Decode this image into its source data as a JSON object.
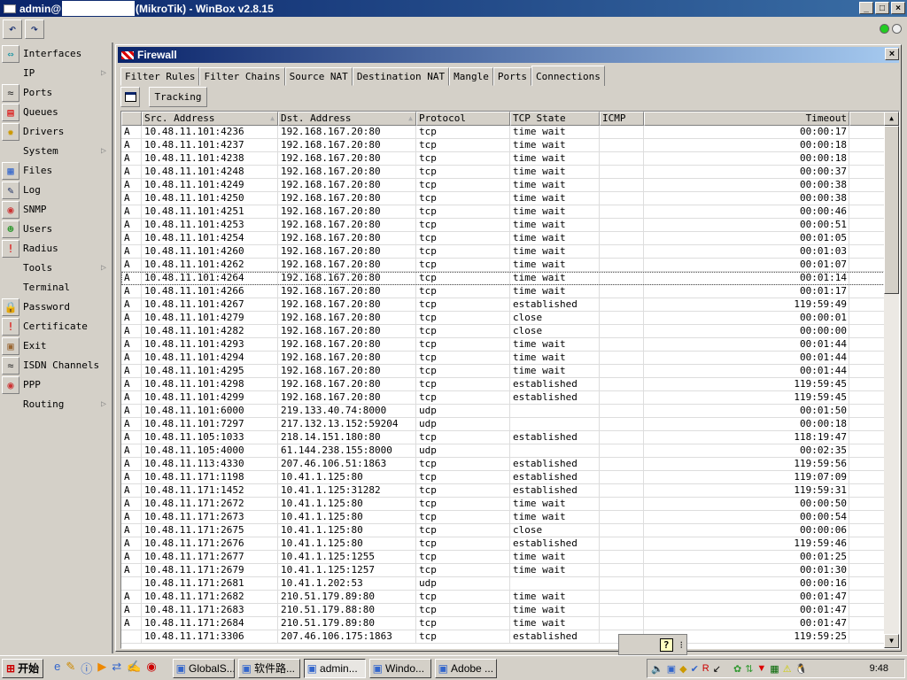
{
  "window": {
    "title_prefix": "admin@",
    "title_suffix": "(MikroTik) - WinBox v2.8.15",
    "minimize": "_",
    "maximize": "□",
    "close": "×"
  },
  "toolbar": {
    "undo": "↶",
    "redo": "↷"
  },
  "sidebar": {
    "items": [
      {
        "label": "Interfaces",
        "icon": "interfaces-icon",
        "glyph": "⇔",
        "color": "#0a8fa0",
        "arrow": false
      },
      {
        "label": "IP",
        "icon": "",
        "glyph": "",
        "color": "",
        "arrow": true
      },
      {
        "label": "Ports",
        "icon": "ports-icon",
        "glyph": "≈",
        "color": "#333",
        "arrow": false
      },
      {
        "label": "Queues",
        "icon": "queues-icon",
        "glyph": "▤",
        "color": "#d00",
        "arrow": false
      },
      {
        "label": "Drivers",
        "icon": "drivers-icon",
        "glyph": "✹",
        "color": "#c90",
        "arrow": false
      },
      {
        "label": "System",
        "icon": "",
        "glyph": "",
        "color": "",
        "arrow": true
      },
      {
        "label": "Files",
        "icon": "files-icon",
        "glyph": "▦",
        "color": "#36c",
        "arrow": false
      },
      {
        "label": "Log",
        "icon": "log-icon",
        "glyph": "✎",
        "color": "#236",
        "arrow": false
      },
      {
        "label": "SNMP",
        "icon": "snmp-icon",
        "glyph": "◉",
        "color": "#c33",
        "arrow": false
      },
      {
        "label": "Users",
        "icon": "users-icon",
        "glyph": "☻",
        "color": "#393",
        "arrow": false
      },
      {
        "label": "Radius",
        "icon": "radius-icon",
        "glyph": "!",
        "color": "#d00",
        "arrow": false
      },
      {
        "label": "Tools",
        "icon": "",
        "glyph": "",
        "color": "",
        "arrow": true
      },
      {
        "label": "Terminal",
        "icon": "",
        "glyph": "",
        "color": "",
        "arrow": false
      },
      {
        "label": "Password",
        "icon": "password-icon",
        "glyph": "🔒",
        "color": "#363",
        "arrow": false
      },
      {
        "label": "Certificate",
        "icon": "certificate-icon",
        "glyph": "!",
        "color": "#d00",
        "arrow": false
      },
      {
        "label": "Exit",
        "icon": "exit-icon",
        "glyph": "▣",
        "color": "#963",
        "arrow": false
      },
      {
        "label": "ISDN Channels",
        "icon": "isdn-icon",
        "glyph": "≈",
        "color": "#333",
        "arrow": false
      },
      {
        "label": "PPP",
        "icon": "ppp-icon",
        "glyph": "◉",
        "color": "#c33",
        "arrow": false
      },
      {
        "label": "Routing",
        "icon": "",
        "glyph": "",
        "color": "",
        "arrow": true
      }
    ]
  },
  "firewall": {
    "title": "Firewall",
    "close": "×",
    "tabs": [
      "Filter Rules",
      "Filter Chains",
      "Source NAT",
      "Destination NAT",
      "Mangle",
      "Ports",
      "Connections"
    ],
    "active_tab": "Connections",
    "tracking_button": "Tracking",
    "columns": [
      "",
      "Src. Address",
      "Dst. Address",
      "Protocol",
      "TCP State",
      "ICMP",
      "Timeout"
    ],
    "rows": [
      [
        "A",
        "10.48.11.101:4236",
        "192.168.167.20:80",
        "tcp",
        "time wait",
        "",
        "00:00:17"
      ],
      [
        "A",
        "10.48.11.101:4237",
        "192.168.167.20:80",
        "tcp",
        "time wait",
        "",
        "00:00:18"
      ],
      [
        "A",
        "10.48.11.101:4238",
        "192.168.167.20:80",
        "tcp",
        "time wait",
        "",
        "00:00:18"
      ],
      [
        "A",
        "10.48.11.101:4248",
        "192.168.167.20:80",
        "tcp",
        "time wait",
        "",
        "00:00:37"
      ],
      [
        "A",
        "10.48.11.101:4249",
        "192.168.167.20:80",
        "tcp",
        "time wait",
        "",
        "00:00:38"
      ],
      [
        "A",
        "10.48.11.101:4250",
        "192.168.167.20:80",
        "tcp",
        "time wait",
        "",
        "00:00:38"
      ],
      [
        "A",
        "10.48.11.101:4251",
        "192.168.167.20:80",
        "tcp",
        "time wait",
        "",
        "00:00:46"
      ],
      [
        "A",
        "10.48.11.101:4253",
        "192.168.167.20:80",
        "tcp",
        "time wait",
        "",
        "00:00:51"
      ],
      [
        "A",
        "10.48.11.101:4254",
        "192.168.167.20:80",
        "tcp",
        "time wait",
        "",
        "00:01:05"
      ],
      [
        "A",
        "10.48.11.101:4260",
        "192.168.167.20:80",
        "tcp",
        "time wait",
        "",
        "00:01:03"
      ],
      [
        "A",
        "10.48.11.101:4262",
        "192.168.167.20:80",
        "tcp",
        "time wait",
        "",
        "00:01:07"
      ],
      [
        "A",
        "10.48.11.101:4264",
        "192.168.167.20:80",
        "tcp",
        "time wait",
        "",
        "00:01:14"
      ],
      [
        "A",
        "10.48.11.101:4266",
        "192.168.167.20:80",
        "tcp",
        "time wait",
        "",
        "00:01:17"
      ],
      [
        "A",
        "10.48.11.101:4267",
        "192.168.167.20:80",
        "tcp",
        "established",
        "",
        "119:59:49"
      ],
      [
        "A",
        "10.48.11.101:4279",
        "192.168.167.20:80",
        "tcp",
        "close",
        "",
        "00:00:01"
      ],
      [
        "A",
        "10.48.11.101:4282",
        "192.168.167.20:80",
        "tcp",
        "close",
        "",
        "00:00:00"
      ],
      [
        "A",
        "10.48.11.101:4293",
        "192.168.167.20:80",
        "tcp",
        "time wait",
        "",
        "00:01:44"
      ],
      [
        "A",
        "10.48.11.101:4294",
        "192.168.167.20:80",
        "tcp",
        "time wait",
        "",
        "00:01:44"
      ],
      [
        "A",
        "10.48.11.101:4295",
        "192.168.167.20:80",
        "tcp",
        "time wait",
        "",
        "00:01:44"
      ],
      [
        "A",
        "10.48.11.101:4298",
        "192.168.167.20:80",
        "tcp",
        "established",
        "",
        "119:59:45"
      ],
      [
        "A",
        "10.48.11.101:4299",
        "192.168.167.20:80",
        "tcp",
        "established",
        "",
        "119:59:45"
      ],
      [
        "A",
        "10.48.11.101:6000",
        "219.133.40.74:8000",
        "udp",
        "",
        "",
        "00:01:50"
      ],
      [
        "A",
        "10.48.11.101:7297",
        "217.132.13.152:59204",
        "udp",
        "",
        "",
        "00:00:18"
      ],
      [
        "A",
        "10.48.11.105:1033",
        "218.14.151.180:80",
        "tcp",
        "established",
        "",
        "118:19:47"
      ],
      [
        "A",
        "10.48.11.105:4000",
        "61.144.238.155:8000",
        "udp",
        "",
        "",
        "00:02:35"
      ],
      [
        "A",
        "10.48.11.113:4330",
        "207.46.106.51:1863",
        "tcp",
        "established",
        "",
        "119:59:56"
      ],
      [
        "A",
        "10.48.11.171:1198",
        "10.41.1.125:80",
        "tcp",
        "established",
        "",
        "119:07:09"
      ],
      [
        "A",
        "10.48.11.171:1452",
        "10.41.1.125:31282",
        "tcp",
        "established",
        "",
        "119:59:31"
      ],
      [
        "A",
        "10.48.11.171:2672",
        "10.41.1.125:80",
        "tcp",
        "time wait",
        "",
        "00:00:50"
      ],
      [
        "A",
        "10.48.11.171:2673",
        "10.41.1.125:80",
        "tcp",
        "time wait",
        "",
        "00:00:54"
      ],
      [
        "A",
        "10.48.11.171:2675",
        "10.41.1.125:80",
        "tcp",
        "close",
        "",
        "00:00:06"
      ],
      [
        "A",
        "10.48.11.171:2676",
        "10.41.1.125:80",
        "tcp",
        "established",
        "",
        "119:59:46"
      ],
      [
        "A",
        "10.48.11.171:2677",
        "10.41.1.125:1255",
        "tcp",
        "time wait",
        "",
        "00:01:25"
      ],
      [
        "A",
        "10.48.11.171:2679",
        "10.41.1.125:1257",
        "tcp",
        "time wait",
        "",
        "00:01:30"
      ],
      [
        "",
        "10.48.11.171:2681",
        "10.41.1.202:53",
        "udp",
        "",
        "",
        "00:00:16"
      ],
      [
        "A",
        "10.48.11.171:2682",
        "210.51.179.89:80",
        "tcp",
        "time wait",
        "",
        "00:01:47"
      ],
      [
        "A",
        "10.48.11.171:2683",
        "210.51.179.88:80",
        "tcp",
        "time wait",
        "",
        "00:01:47"
      ],
      [
        "A",
        "10.48.11.171:2684",
        "210.51.179.89:80",
        "tcp",
        "time wait",
        "",
        "00:01:47"
      ],
      [
        "",
        "10.48.11.171:3306",
        "207.46.106.175:1863",
        "tcp",
        "established",
        "",
        "119:59:25"
      ]
    ],
    "focused_row": 11
  },
  "helpbar": {
    "help": "?"
  },
  "taskbar": {
    "start": "开始",
    "tasks": [
      "GlobalS...",
      "软件路...",
      "admin...",
      "Windo...",
      "Adobe ..."
    ],
    "active_task": 2,
    "clock": "9:48"
  }
}
